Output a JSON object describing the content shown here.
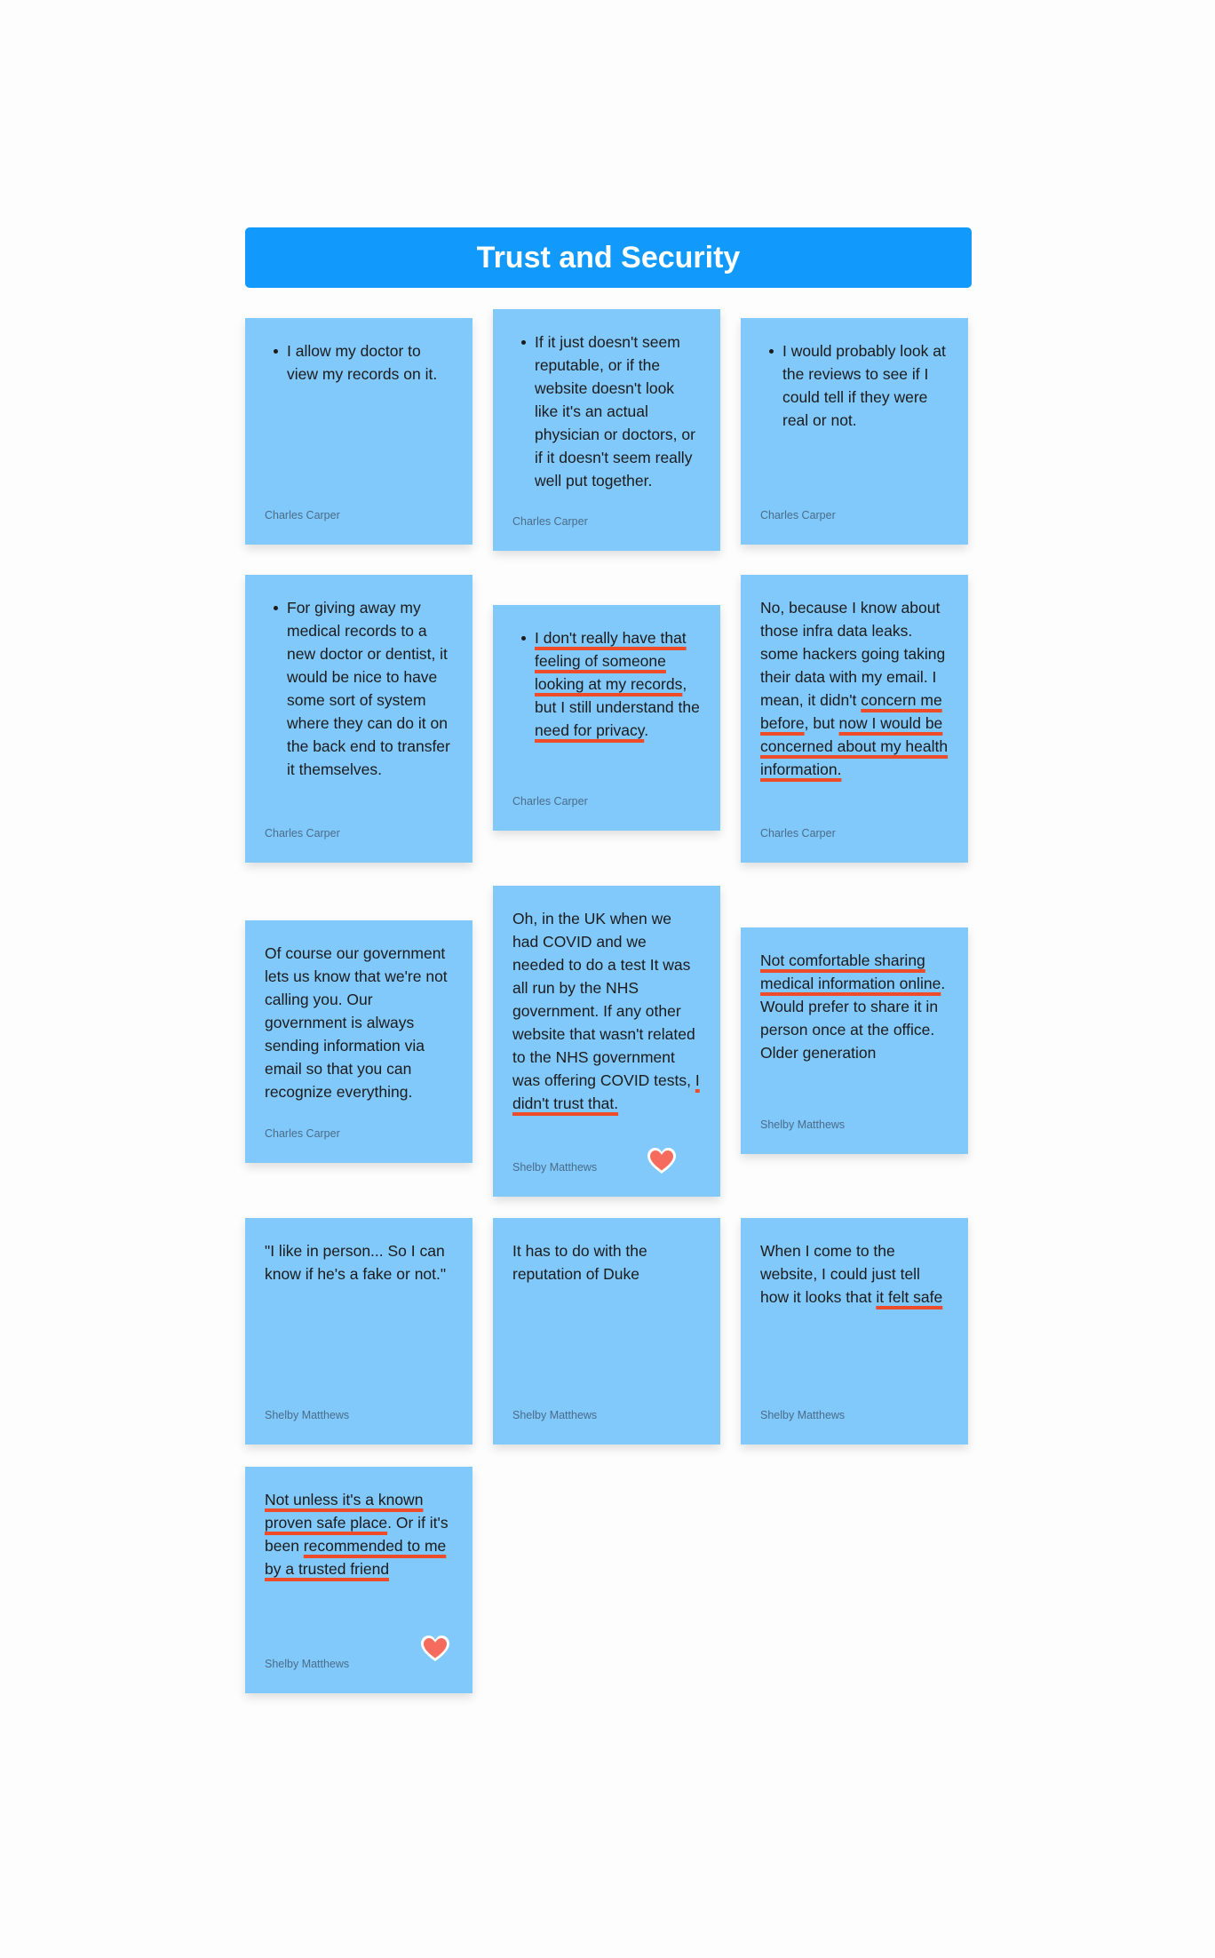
{
  "header": {
    "title": "Trust and Security"
  },
  "notes": [
    {
      "segments": [
        {
          "t": "I allow my doctor to view my records on it."
        }
      ],
      "author": "Charles Carper"
    },
    {
      "segments": [
        {
          "t": "If it just doesn't seem reputable, or if the website doesn't look like it's an actual physician or doctors, or if it doesn't seem really well put together."
        }
      ],
      "author": "Charles Carper"
    },
    {
      "segments": [
        {
          "t": "I would probably look at the reviews to see if I could tell if they were real or not."
        }
      ],
      "author": "Charles Carper"
    },
    {
      "segments": [
        {
          "t": "For giving away my medical records to a new doctor or dentist, it would be nice to have some sort of system where they can do it on the back end to transfer it themselves."
        }
      ],
      "author": "Charles Carper"
    },
    {
      "segments": [
        {
          "t": "I don't really have that feeling of someone looking at my records",
          "hl": true
        },
        {
          "t": ", but I still understand the "
        },
        {
          "t": "need for privacy",
          "hl": true
        },
        {
          "t": "."
        }
      ],
      "author": "Charles Carper"
    },
    {
      "segments": [
        {
          "t": "No, because I know about those infra data leaks. some hackers going taking their data with my email. I mean, it didn't "
        },
        {
          "t": "concern me before",
          "hl": true
        },
        {
          "t": ", but "
        },
        {
          "t": "now I would be concerned about my health information.",
          "hl": true
        }
      ],
      "author": "Charles Carper"
    },
    {
      "segments": [
        {
          "t": "Of course our government lets us know that we're not calling you. Our government is always sending information via email so that you can recognize everything."
        }
      ],
      "author": "Charles Carper"
    },
    {
      "segments": [
        {
          "t": "Oh, in the UK when we had COVID and we needed to do a test It was all run by the NHS government. If any other website that wasn't related to the NHS government was offering COVID tests, "
        },
        {
          "t": "I didn't trust that.",
          "hl": true
        }
      ],
      "author": "Shelby Matthews"
    },
    {
      "segments": [
        {
          "t": "Not comfortable sharing medical information online",
          "hl": true
        },
        {
          "t": ". Would prefer to share it in person once at the office. Older generation"
        }
      ],
      "author": "Shelby Matthews"
    },
    {
      "segments": [
        {
          "t": "\"I like in person... So I can know if he's a fake or not.\""
        }
      ],
      "author": "Shelby Matthews"
    },
    {
      "segments": [
        {
          "t": "It has to do with the reputation of Duke"
        }
      ],
      "author": "Shelby Matthews"
    },
    {
      "segments": [
        {
          "t": "When I come to the website, I could just tell how it looks that "
        },
        {
          "t": "it felt safe",
          "hl": true
        }
      ],
      "author": "Shelby Matthews"
    },
    {
      "segments": [
        {
          "t": "Not unless it's a known proven safe place",
          "hl": true
        },
        {
          "t": ". Or if it's been "
        },
        {
          "t": "recommended to me by a trusted friend",
          "hl": true
        }
      ],
      "author": "Shelby Matthews"
    }
  ],
  "reactions": {
    "heart_color": "#f56b5d",
    "icon": "heart-icon"
  }
}
